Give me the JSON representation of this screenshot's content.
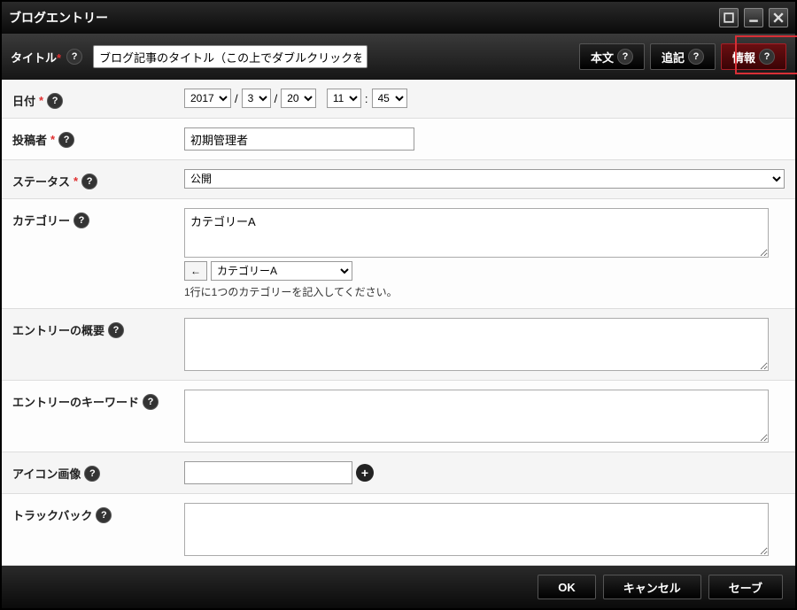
{
  "window": {
    "title": "ブログエントリー"
  },
  "toolbar": {
    "title_label": "タイトル",
    "title_value": "ブログ記事のタイトル（この上でダブルクリックをし"
  },
  "tabs": {
    "body": "本文",
    "append": "追記",
    "info": "情報"
  },
  "fields": {
    "date": {
      "label": "日付",
      "year": "2017",
      "month": "3",
      "day": "20",
      "hour": "11",
      "minute": "45"
    },
    "author": {
      "label": "投稿者",
      "value": "初期管理者"
    },
    "status": {
      "label": "ステータス",
      "value": "公開"
    },
    "category": {
      "label": "カテゴリー",
      "value": "カテゴリーA",
      "select_value": "カテゴリーA",
      "arrow": "←",
      "hint": "1行に1つのカテゴリーを記入してください。"
    },
    "summary": {
      "label": "エントリーの概要",
      "value": ""
    },
    "keywords": {
      "label": "エントリーのキーワード",
      "value": ""
    },
    "icon": {
      "label": "アイコン画像",
      "value": ""
    },
    "trackback": {
      "label": "トラックバック",
      "value": ""
    }
  },
  "footer": {
    "ok": "OK",
    "cancel": "キャンセル",
    "save": "セーブ"
  }
}
